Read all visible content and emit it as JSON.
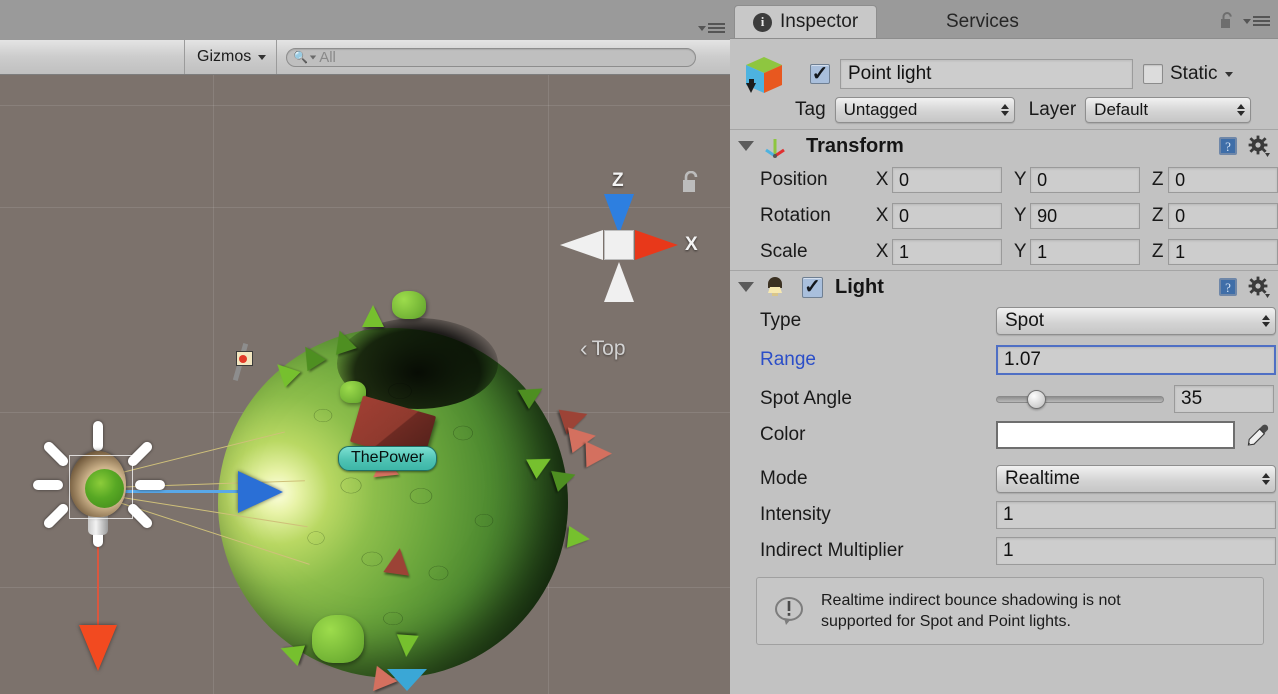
{
  "scene_view": {
    "toolbar": {
      "gizmos_label": "Gizmos",
      "gizmos_caret_icon": "chevron-down-icon",
      "search_icon": "search-icon",
      "search_value": "All",
      "search_placeholder": "All"
    },
    "panel_menu_icon": "panel-options-icon",
    "axis_gizmo": {
      "z_label": "Z",
      "x_label": "X",
      "view_label": "Top",
      "view_prev_icon": "chevron-left-icon",
      "z_color": "#2d7fe0",
      "x_color": "#e8381a",
      "neutral_color": "#f0f0f0"
    },
    "lock_icon": "lock-open-icon",
    "objects": {
      "selected_label": "ThePower",
      "label_bg_color": "#4fc3b4",
      "light_gizmo_icon": "light-gizmo-icon",
      "move_handle_blue_icon": "axis-arrow-blue-icon",
      "move_handle_red_icon": "axis-arrow-red-icon"
    },
    "background_color": "#7c726c"
  },
  "inspector": {
    "tabs": [
      {
        "label": "Inspector",
        "icon": "info-icon",
        "active": true
      },
      {
        "label": "Services",
        "icon": "",
        "active": false
      }
    ],
    "lock_icon": "lock-open-icon",
    "menu_icon": "panel-options-icon",
    "game_object": {
      "prefab_icon": "prefab-cube-icon",
      "enabled": true,
      "enabled_check_icon": "checkmark-icon",
      "name": "Point light",
      "static_label": "Static",
      "static_checked": false,
      "static_caret_icon": "chevron-down-icon",
      "tag_label": "Tag",
      "tag_value": "Untagged",
      "layer_label": "Layer",
      "layer_value": "Default"
    },
    "components": [
      {
        "title": "Transform",
        "icon": "transform-axis-icon",
        "foldout_icon": "triangle-down-icon",
        "help_icon": "help-book-icon",
        "settings_icon": "gear-icon",
        "rows": [
          {
            "label": "Position",
            "x": "0",
            "y": "0",
            "z": "0"
          },
          {
            "label": "Rotation",
            "x": "0",
            "y": "90",
            "z": "0"
          },
          {
            "label": "Scale",
            "x": "1",
            "y": "1",
            "z": "1"
          }
        ],
        "axis_labels": {
          "x": "X",
          "y": "Y",
          "z": "Z"
        }
      },
      {
        "title": "Light",
        "icon": "light-bulb-icon",
        "foldout_icon": "triangle-down-icon",
        "enabled": true,
        "enabled_check_icon": "checkmark-icon",
        "help_icon": "help-book-icon",
        "settings_icon": "gear-icon",
        "type_label": "Type",
        "type_value": "Spot",
        "range_label": "Range",
        "range_value": "1.07",
        "range_label_color": "#2b4ec8",
        "range_focused": true,
        "spot_angle_label": "Spot Angle",
        "spot_angle_value": "35",
        "spot_angle_fraction": 0.2,
        "color_label": "Color",
        "color_value": "#ffffff",
        "eyedropper_icon": "eyedropper-icon",
        "mode_label": "Mode",
        "mode_value": "Realtime",
        "intensity_label": "Intensity",
        "intensity_value": "1",
        "indirect_label": "Indirect Multiplier",
        "indirect_value": "1",
        "helpbox_icon": "warning-speech-icon",
        "helpbox_line1": "Realtime indirect bounce shadowing is not",
        "helpbox_line2": "supported for Spot and Point lights."
      }
    ]
  }
}
